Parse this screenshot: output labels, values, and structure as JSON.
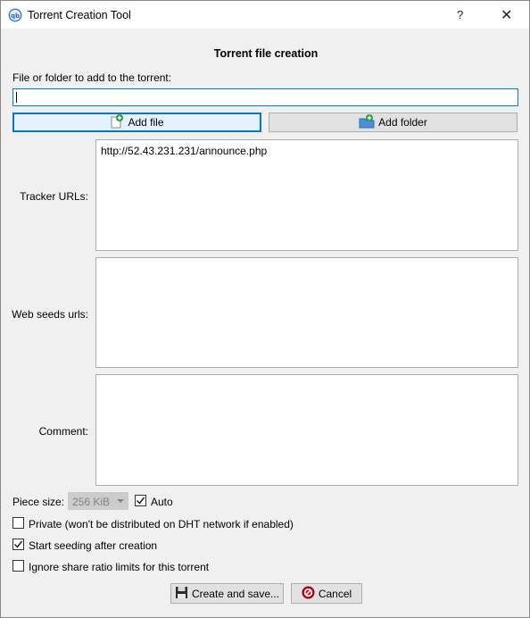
{
  "window": {
    "title": "Torrent Creation Tool",
    "help": "?",
    "close": "✕"
  },
  "heading": "Torrent file creation",
  "file_label": "File or folder to add to the torrent:",
  "file_value": "",
  "buttons": {
    "add_file": "Add file",
    "add_folder": "Add folder",
    "create": "Create and save...",
    "cancel": "Cancel"
  },
  "tracker": {
    "label": "Tracker URLs:",
    "value": "http://52.43.231.231/announce.php"
  },
  "webseeds": {
    "label": "Web seeds urls:",
    "value": ""
  },
  "comment": {
    "label": "Comment:",
    "value": ""
  },
  "piece_size": {
    "label": "Piece size:",
    "value": "256 KiB",
    "auto_label": "Auto",
    "auto_checked": true
  },
  "options": [
    {
      "label": "Private (won't be distributed on DHT network if enabled)",
      "checked": false
    },
    {
      "label": "Start seeding after creation",
      "checked": true
    },
    {
      "label": "Ignore share ratio limits for this torrent",
      "checked": false
    }
  ],
  "colors": {
    "focus": "#0078d7",
    "cancel_red": "#d0021b",
    "add_green": "#2e9a3a"
  },
  "icons": {
    "app": "qbittorrent-icon",
    "add_file": "add-file-icon",
    "add_folder": "add-folder-icon",
    "save": "floppy-save-icon",
    "cancel": "cancel-icon"
  }
}
